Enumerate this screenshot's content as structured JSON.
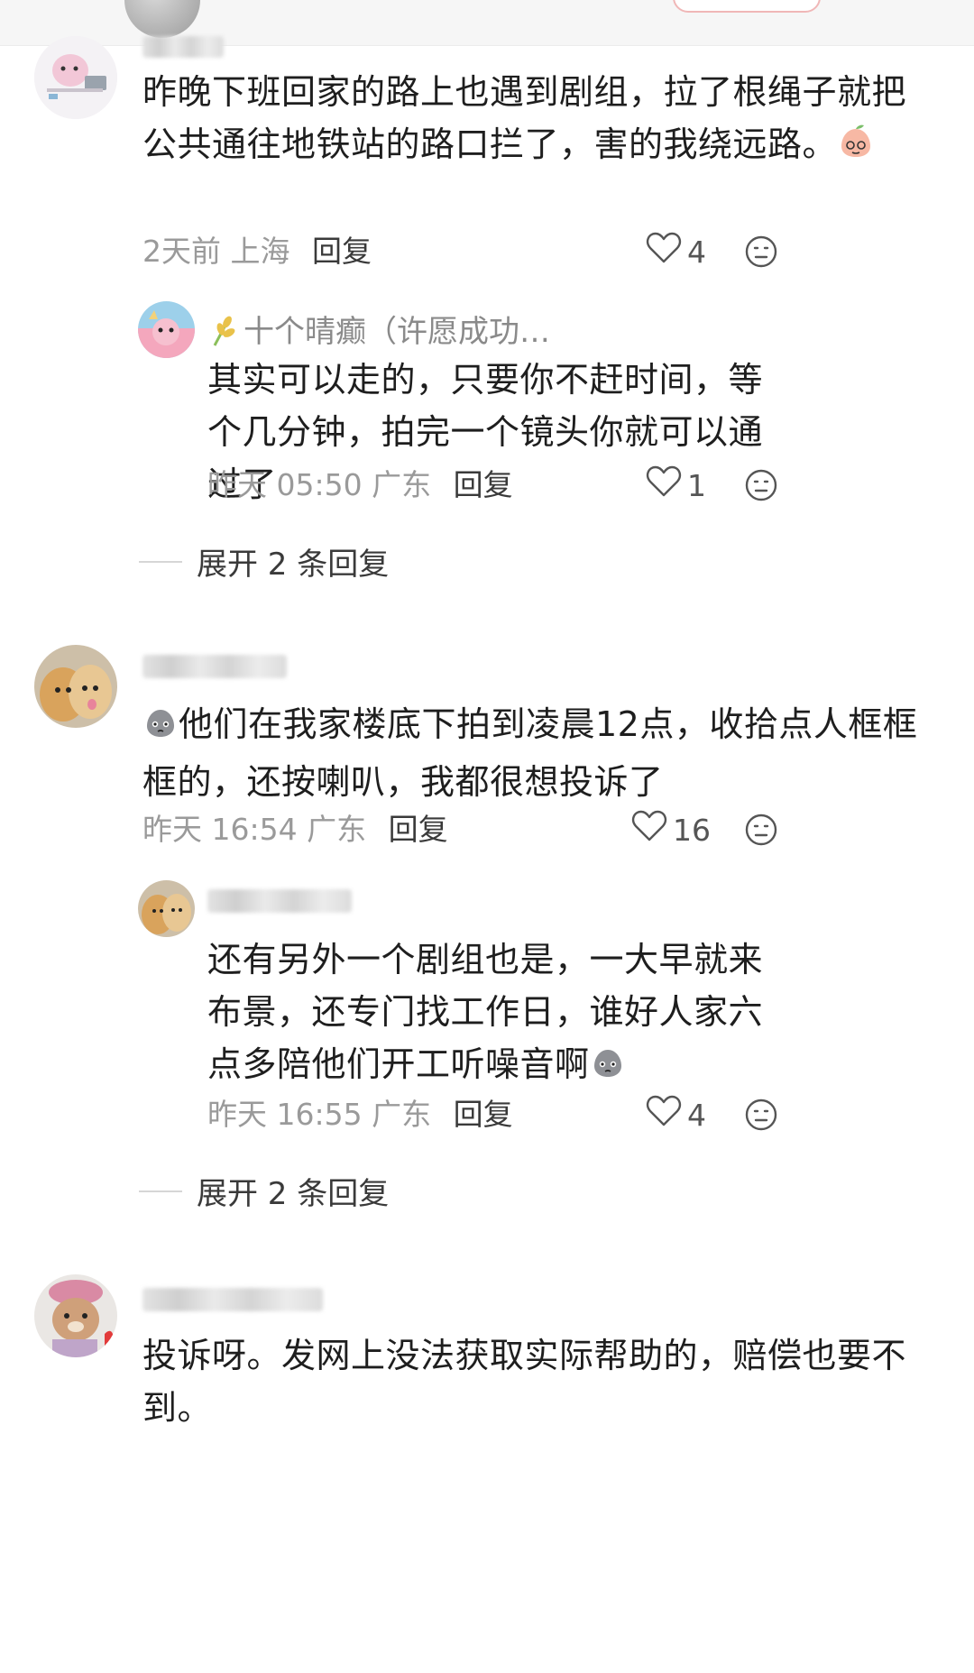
{
  "comments": [
    {
      "text": "昨晚下班回家的路上也遇到剧组，拉了根绳子就把公共通往地铁站的路口拦了，害的我绕远路。",
      "time": "2天前",
      "location": "上海",
      "reply_label": "回复",
      "likes": "4",
      "subreply": {
        "name": "十个晴癫（许愿成功…",
        "text": "其实可以走的，只要你不赶时间，等个几分钟，拍完一个镜头你就可以通过了",
        "time": "昨天 05:50",
        "location": "广东",
        "reply_label": "回复",
        "likes": "1"
      },
      "expand_label": "展开 2 条回复"
    },
    {
      "text": "他们在我家楼底下拍到凌晨12点，收拾点人框框框的，还按喇叭，我都很想投诉了",
      "time": "昨天 16:54",
      "location": "广东",
      "reply_label": "回复",
      "likes": "16",
      "subreply": {
        "text": "还有另外一个剧组也是，一大早就来布景，还专门找工作日，谁好人家六点多陪他们开工听噪音啊",
        "time": "昨天 16:55",
        "location": "广东",
        "reply_label": "回复",
        "likes": "4"
      },
      "expand_label": "展开 2 条回复"
    },
    {
      "text": "投诉呀。发网上没法获取实际帮助的，赔偿也要不到。"
    }
  ],
  "colors": {
    "meta_gray": "#9a9a9a",
    "text_dark": "#1e1e1e",
    "icon_gray": "#666666"
  }
}
